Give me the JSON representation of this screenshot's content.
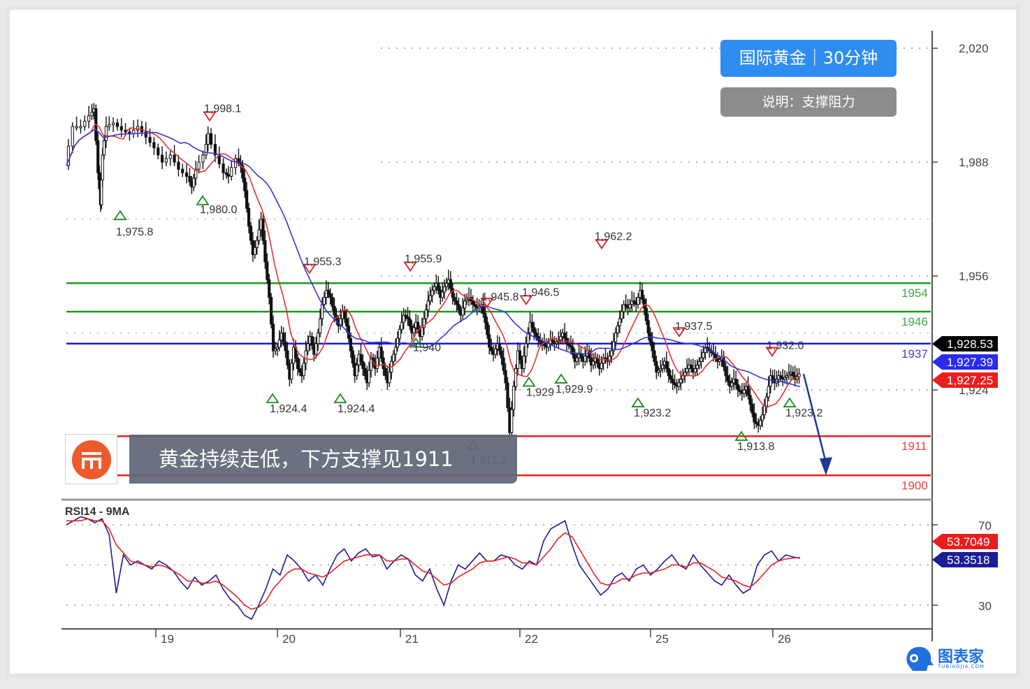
{
  "header": {
    "title": "国际黄金｜30分钟",
    "subtitle": "说明：支撑阻力"
  },
  "caption": "黄金持续走低，下方支撑见1911",
  "brand": {
    "name": "图表家",
    "sub": "TUBIAOJIA.COM"
  },
  "colors": {
    "support_green": "#1e9a1e",
    "pivot_blue": "#1818e0",
    "support_red": "#e82020",
    "ma_red": "#e83030",
    "ma_blue": "#3636d8",
    "rsi_line": "#1c1c96",
    "rsi_ma": "#e82020",
    "title_badge": "#2f8cf0",
    "arrow": "#1a3a96"
  },
  "chart_data": [
    {
      "type": "candlestick",
      "timeframe": "30分钟",
      "ylim": [
        1900,
        2020
      ],
      "y_ticks": [
        "2,020",
        "1,988",
        "1,956",
        "1,924"
      ],
      "x_ticks": [
        "19",
        "20",
        "21",
        "22",
        "25",
        "26"
      ],
      "price_tags": [
        {
          "label": "1,928.53",
          "color": "#000000"
        },
        {
          "label": "1,927.39",
          "color": "#2a2af0"
        },
        {
          "label": "1,927.25",
          "color": "#e81e1e"
        }
      ],
      "horizontal_levels": [
        {
          "value": 1954,
          "label": "1954",
          "color": "#1e9a1e"
        },
        {
          "value": 1946,
          "label": "1946",
          "color": "#1e9a1e"
        },
        {
          "value": 1937,
          "label": "1937",
          "color": "#1818e0"
        },
        {
          "value": 1911,
          "label": "1911",
          "color": "#e82020"
        },
        {
          "value": 1900,
          "label": "1900",
          "color": "#e82020"
        }
      ],
      "swing_points": [
        {
          "label": "1,975.8",
          "type": "low",
          "value": 1975.8
        },
        {
          "label": "1,998.1",
          "type": "high",
          "value": 1998.1
        },
        {
          "label": "1,980.0",
          "type": "low",
          "value": 1980.0
        },
        {
          "label": "1,955.3",
          "type": "high",
          "value": 1955.3
        },
        {
          "label": "1,924.4",
          "type": "low",
          "value": 1924.4
        },
        {
          "label": "1,924.4",
          "type": "low",
          "value": 1924.4
        },
        {
          "label": "1,955.9",
          "type": "high",
          "value": 1955.9
        },
        {
          "label": "1,940",
          "type": "low",
          "value": 1940.0
        },
        {
          "label": "1,945.8",
          "type": "high",
          "value": 1945.8
        },
        {
          "label": "1,946.5",
          "type": "high",
          "value": 1946.5
        },
        {
          "label": "1,929",
          "type": "low",
          "value": 1929.0
        },
        {
          "label": "1,929.9",
          "type": "low",
          "value": 1929.9
        },
        {
          "label": "1,911.2",
          "type": "low",
          "value": 1911.2
        },
        {
          "label": "1,962.2",
          "type": "high",
          "value": 1962.2
        },
        {
          "label": "1,923.2",
          "type": "low",
          "value": 1923.2
        },
        {
          "label": "1,937.5",
          "type": "high",
          "value": 1937.5
        },
        {
          "label": "1,913.8",
          "type": "low",
          "value": 1913.8
        },
        {
          "label": "1,932.0",
          "type": "high",
          "value": 1932.0
        },
        {
          "label": "1,923.2",
          "type": "low",
          "value": 1923.2
        }
      ],
      "price_path": [
        [
          0,
          1987
        ],
        [
          4,
          1998
        ],
        [
          8,
          1998
        ],
        [
          12,
          2001
        ],
        [
          14,
          2003
        ],
        [
          16,
          1985
        ],
        [
          17,
          1976
        ],
        [
          18,
          1990
        ],
        [
          20,
          1998
        ],
        [
          24,
          1999
        ],
        [
          28,
          1997
        ],
        [
          32,
          1996
        ],
        [
          36,
          1998
        ],
        [
          40,
          1995
        ],
        [
          44,
          1992
        ],
        [
          48,
          1988
        ],
        [
          52,
          1990
        ],
        [
          56,
          1986
        ],
        [
          60,
          1984
        ],
        [
          62,
          1981
        ],
        [
          64,
          1986
        ],
        [
          68,
          1990
        ],
        [
          70,
          1996
        ],
        [
          74,
          1990
        ],
        [
          78,
          1985
        ],
        [
          80,
          1984
        ],
        [
          84,
          1989
        ],
        [
          86,
          1987
        ],
        [
          88,
          1980
        ],
        [
          90,
          1970
        ],
        [
          92,
          1962
        ],
        [
          94,
          1966
        ],
        [
          96,
          1972
        ],
        [
          98,
          1960
        ],
        [
          100,
          1950
        ],
        [
          102,
          1935
        ],
        [
          104,
          1936
        ],
        [
          106,
          1940
        ],
        [
          108,
          1935
        ],
        [
          110,
          1927
        ],
        [
          112,
          1936
        ],
        [
          114,
          1930
        ],
        [
          116,
          1928
        ],
        [
          118,
          1935
        ],
        [
          120,
          1939
        ],
        [
          122,
          1934
        ],
        [
          124,
          1940
        ],
        [
          126,
          1948
        ],
        [
          128,
          1952
        ],
        [
          130,
          1950
        ],
        [
          132,
          1945
        ],
        [
          134,
          1942
        ],
        [
          136,
          1946
        ],
        [
          138,
          1942
        ],
        [
          140,
          1935
        ],
        [
          142,
          1928
        ],
        [
          144,
          1934
        ],
        [
          146,
          1930
        ],
        [
          148,
          1926
        ],
        [
          150,
          1933
        ],
        [
          152,
          1930
        ],
        [
          154,
          1936
        ],
        [
          156,
          1930
        ],
        [
          158,
          1926
        ],
        [
          160,
          1932
        ],
        [
          162,
          1936
        ],
        [
          164,
          1941
        ],
        [
          166,
          1945
        ],
        [
          168,
          1944
        ],
        [
          170,
          1940
        ],
        [
          172,
          1943
        ],
        [
          174,
          1939
        ],
        [
          176,
          1944
        ],
        [
          178,
          1949
        ],
        [
          180,
          1952
        ],
        [
          182,
          1954
        ],
        [
          184,
          1950
        ],
        [
          186,
          1953
        ],
        [
          188,
          1955
        ],
        [
          190,
          1950
        ],
        [
          192,
          1948
        ],
        [
          194,
          1945
        ],
        [
          196,
          1949
        ],
        [
          198,
          1950
        ],
        [
          200,
          1948
        ],
        [
          202,
          1947
        ],
        [
          204,
          1948
        ],
        [
          206,
          1943
        ],
        [
          208,
          1936
        ],
        [
          210,
          1934
        ],
        [
          212,
          1937
        ],
        [
          214,
          1933
        ],
        [
          216,
          1926
        ],
        [
          218,
          1912
        ],
        [
          220,
          1925
        ],
        [
          222,
          1935
        ],
        [
          224,
          1930
        ],
        [
          226,
          1937
        ],
        [
          228,
          1943
        ],
        [
          230,
          1940
        ],
        [
          232,
          1938
        ],
        [
          234,
          1937
        ],
        [
          236,
          1936
        ],
        [
          238,
          1938
        ],
        [
          240,
          1937
        ],
        [
          242,
          1938
        ],
        [
          244,
          1940
        ],
        [
          246,
          1937
        ],
        [
          248,
          1936
        ],
        [
          250,
          1932
        ],
        [
          252,
          1934
        ],
        [
          254,
          1932
        ],
        [
          256,
          1935
        ],
        [
          258,
          1931
        ],
        [
          260,
          1933
        ],
        [
          262,
          1930
        ],
        [
          264,
          1933
        ],
        [
          266,
          1932
        ],
        [
          268,
          1935
        ],
        [
          270,
          1940
        ],
        [
          272,
          1944
        ],
        [
          274,
          1948
        ],
        [
          276,
          1947
        ],
        [
          278,
          1949
        ],
        [
          280,
          1948
        ],
        [
          282,
          1952
        ],
        [
          284,
          1947
        ],
        [
          286,
          1940
        ],
        [
          288,
          1935
        ],
        [
          290,
          1929
        ],
        [
          292,
          1930
        ],
        [
          294,
          1932
        ],
        [
          296,
          1928
        ],
        [
          298,
          1926
        ],
        [
          300,
          1925
        ],
        [
          302,
          1927
        ],
        [
          304,
          1929
        ],
        [
          306,
          1931
        ],
        [
          308,
          1929
        ],
        [
          310,
          1931
        ],
        [
          312,
          1933
        ],
        [
          314,
          1936
        ],
        [
          316,
          1935
        ],
        [
          318,
          1934
        ],
        [
          320,
          1932
        ],
        [
          322,
          1933
        ],
        [
          324,
          1928
        ],
        [
          326,
          1925
        ],
        [
          328,
          1927
        ],
        [
          330,
          1924
        ],
        [
          332,
          1923
        ],
        [
          334,
          1925
        ],
        [
          336,
          1920
        ],
        [
          338,
          1915
        ],
        [
          340,
          1914
        ],
        [
          342,
          1917
        ],
        [
          344,
          1922
        ],
        [
          346,
          1928
        ],
        [
          348,
          1926
        ],
        [
          350,
          1928
        ],
        [
          352,
          1927
        ],
        [
          354,
          1928
        ],
        [
          356,
          1929
        ],
        [
          358,
          1927
        ],
        [
          360,
          1928.5
        ]
      ],
      "moving_averages": [
        {
          "name": "fast",
          "color": "#e83030"
        },
        {
          "name": "slow",
          "color": "#3636d8"
        }
      ],
      "projection": {
        "from": 1928.5,
        "to": 1900
      }
    },
    {
      "type": "line",
      "title": "RSI14 - 9MA",
      "ylim": [
        20,
        80
      ],
      "y_ticks": [
        "70",
        "30"
      ],
      "value_tags": [
        {
          "label": "53.7049",
          "color": "#e81e1e"
        },
        {
          "label": "53.3518",
          "color": "#1c1c96"
        }
      ],
      "series": [
        {
          "name": "RSI14",
          "values": [
            70,
            72,
            74,
            73,
            71,
            73,
            65,
            36,
            55,
            50,
            52,
            50,
            48,
            52,
            50,
            47,
            42,
            38,
            44,
            40,
            42,
            45,
            38,
            33,
            30,
            25,
            23,
            30,
            38,
            48,
            45,
            55,
            52,
            48,
            42,
            45,
            40,
            48,
            55,
            58,
            52,
            56,
            58,
            54,
            55,
            48,
            52,
            55,
            53,
            45,
            42,
            48,
            38,
            30,
            42,
            50,
            48,
            52,
            56,
            52,
            52,
            55,
            54,
            50,
            48,
            52,
            50,
            62,
            68,
            70,
            72,
            60,
            50,
            45,
            40,
            35,
            38,
            44,
            46,
            42,
            48,
            50,
            45,
            48,
            52,
            55,
            50,
            48,
            55,
            50,
            46,
            42,
            40,
            45,
            40,
            36,
            38,
            50,
            55,
            57,
            52,
            55,
            54,
            53.35
          ]
        },
        {
          "name": "9MA",
          "values": [
            72,
            72,
            72,
            73,
            72,
            72,
            68,
            60,
            56,
            52,
            51,
            50,
            49,
            50,
            49,
            47,
            45,
            42,
            42,
            41,
            41,
            42,
            40,
            37,
            34,
            30,
            28,
            29,
            32,
            38,
            42,
            46,
            48,
            48,
            46,
            45,
            44,
            46,
            49,
            52,
            53,
            54,
            55,
            55,
            55,
            52,
            52,
            53,
            53,
            50,
            47,
            46,
            43,
            40,
            41,
            44,
            46,
            48,
            51,
            52,
            52,
            53,
            54,
            53,
            51,
            51,
            50,
            54,
            58,
            63,
            66,
            64,
            58,
            52,
            46,
            41,
            40,
            41,
            43,
            43,
            45,
            46,
            46,
            47,
            48,
            50,
            50,
            49,
            51,
            51,
            49,
            47,
            44,
            43,
            42,
            40,
            39,
            42,
            46,
            50,
            52,
            53,
            53.5,
            53.7
          ]
        }
      ]
    }
  ]
}
